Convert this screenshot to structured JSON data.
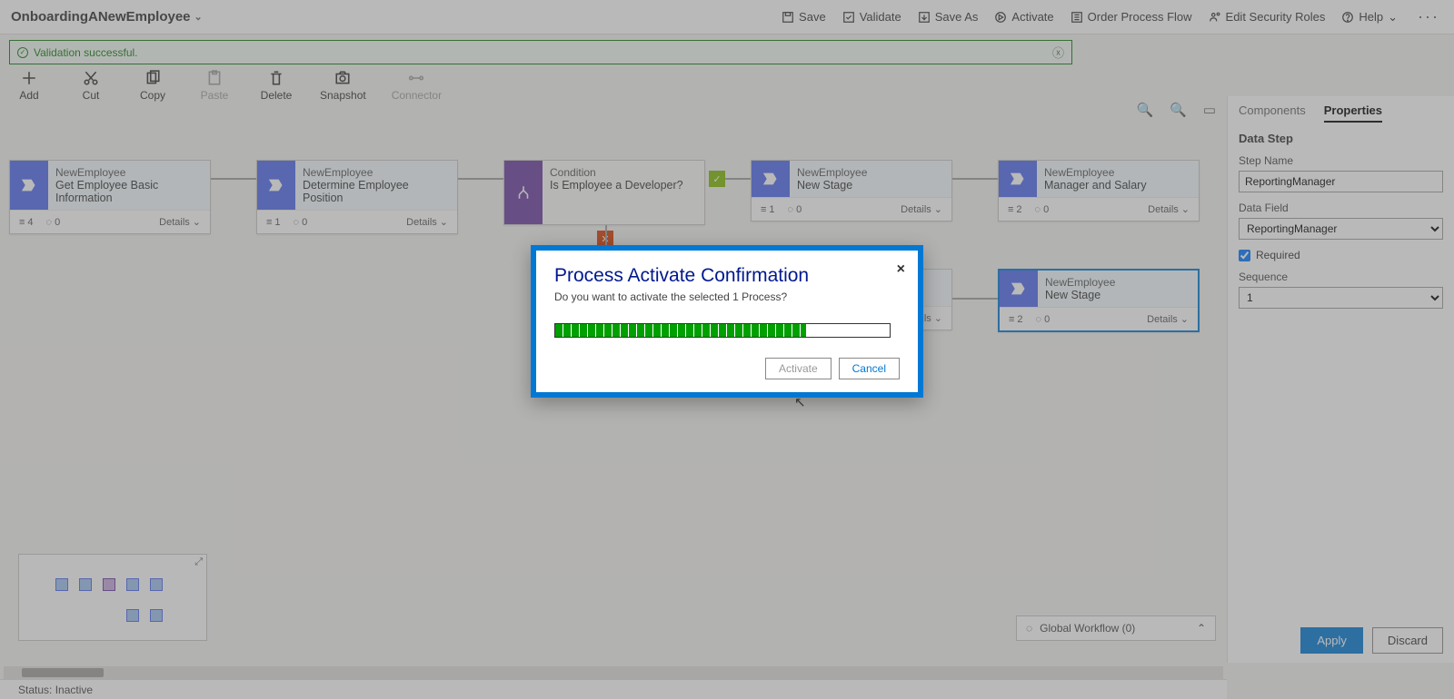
{
  "header": {
    "title": "OnboardingANewEmployee",
    "actions": {
      "save": "Save",
      "validate": "Validate",
      "saveAs": "Save As",
      "activate": "Activate",
      "orderFlow": "Order Process Flow",
      "editSecurity": "Edit Security Roles",
      "help": "Help"
    }
  },
  "validation": {
    "message": "Validation successful."
  },
  "toolbar": {
    "add": "Add",
    "cut": "Cut",
    "copy": "Copy",
    "paste": "Paste",
    "delete": "Delete",
    "snapshot": "Snapshot",
    "connector": "Connector"
  },
  "stages": [
    {
      "entity": "NewEmployee",
      "name": "Get Employee Basic Information",
      "steps": "4",
      "flows": "0",
      "details": "Details"
    },
    {
      "entity": "NewEmployee",
      "name": "Determine Employee Position",
      "steps": "1",
      "flows": "0",
      "details": "Details"
    },
    {
      "entity": "Condition",
      "name": "Is Employee a Developer?",
      "details": ""
    },
    {
      "entity": "NewEmployee",
      "name": "New Stage",
      "steps": "1",
      "flows": "0",
      "details": "Details"
    },
    {
      "entity": "NewEmployee",
      "name": "Manager and Salary",
      "steps": "2",
      "flows": "0",
      "details": "Details"
    },
    {
      "entity": "NewEmployee",
      "name": "New Stage",
      "steps": "2",
      "flows": "0",
      "details": "Details"
    }
  ],
  "panel": {
    "tabs": {
      "components": "Components",
      "properties": "Properties"
    },
    "sectionTitle": "Data Step",
    "stepNameLabel": "Step Name",
    "stepNameValue": "ReportingManager",
    "dataFieldLabel": "Data Field",
    "dataFieldValue": "ReportingManager",
    "requiredLabel": "Required",
    "sequenceLabel": "Sequence",
    "sequenceValue": "1",
    "apply": "Apply",
    "discard": "Discard"
  },
  "globalWorkflow": {
    "label": "Global Workflow (0)"
  },
  "status": {
    "label": "Status:",
    "value": "Inactive"
  },
  "modal": {
    "title": "Process Activate Confirmation",
    "message": "Do you want to activate the selected 1 Process?",
    "activate": "Activate",
    "cancel": "Cancel"
  },
  "canvasDetails": "Details"
}
